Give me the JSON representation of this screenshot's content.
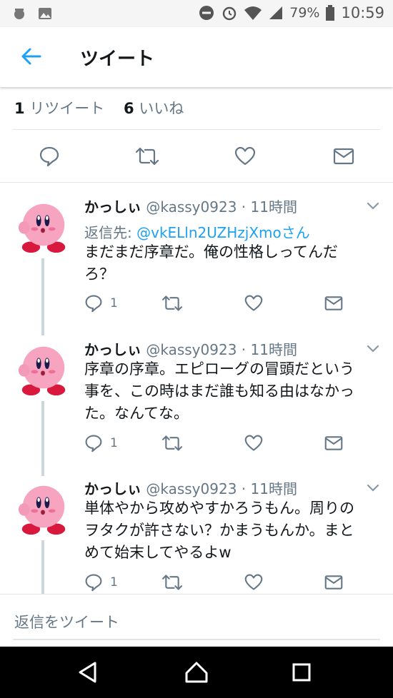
{
  "status": {
    "battery": "79%",
    "time": "10:59"
  },
  "appbar": {
    "title": "ツイート"
  },
  "stats": {
    "retweet_count": "1",
    "retweet_label": "リツイート",
    "like_count": "6",
    "like_label": "いいね"
  },
  "tweets": [
    {
      "name": "かっしぃ",
      "handle": "@kassy0923",
      "time": "· 11時間",
      "reply_prefix": "返信先:",
      "reply_to": "@vkELln2UZHzjXmoさん",
      "line1": "まだまだ序章だ。俺の性格しってんだ",
      "line2": "ろ？",
      "line3": "",
      "reply_count": "1"
    },
    {
      "name": "かっしぃ",
      "handle": "@kassy0923",
      "time": "· 11時間",
      "line1": "序章の序章。エピローグの冒頭だという",
      "line2": "事を、この時はまだ誰も知る由はなかっ",
      "line3": "た。なんてな。",
      "reply_count": "1"
    },
    {
      "name": "かっしぃ",
      "handle": "@kassy0923",
      "time": "· 11時間",
      "line1": "単体やから攻めやすかろうもん。周りの",
      "line2": "ヲタクが許さない？かまうもんか。まと",
      "line3": "めて始末してやるよw",
      "reply_count": "1"
    }
  ],
  "composer": {
    "placeholder": "返信をツイート"
  },
  "colors": {
    "accent": "#1da1f2",
    "muted": "#657786",
    "line": "#ccd6dd"
  }
}
